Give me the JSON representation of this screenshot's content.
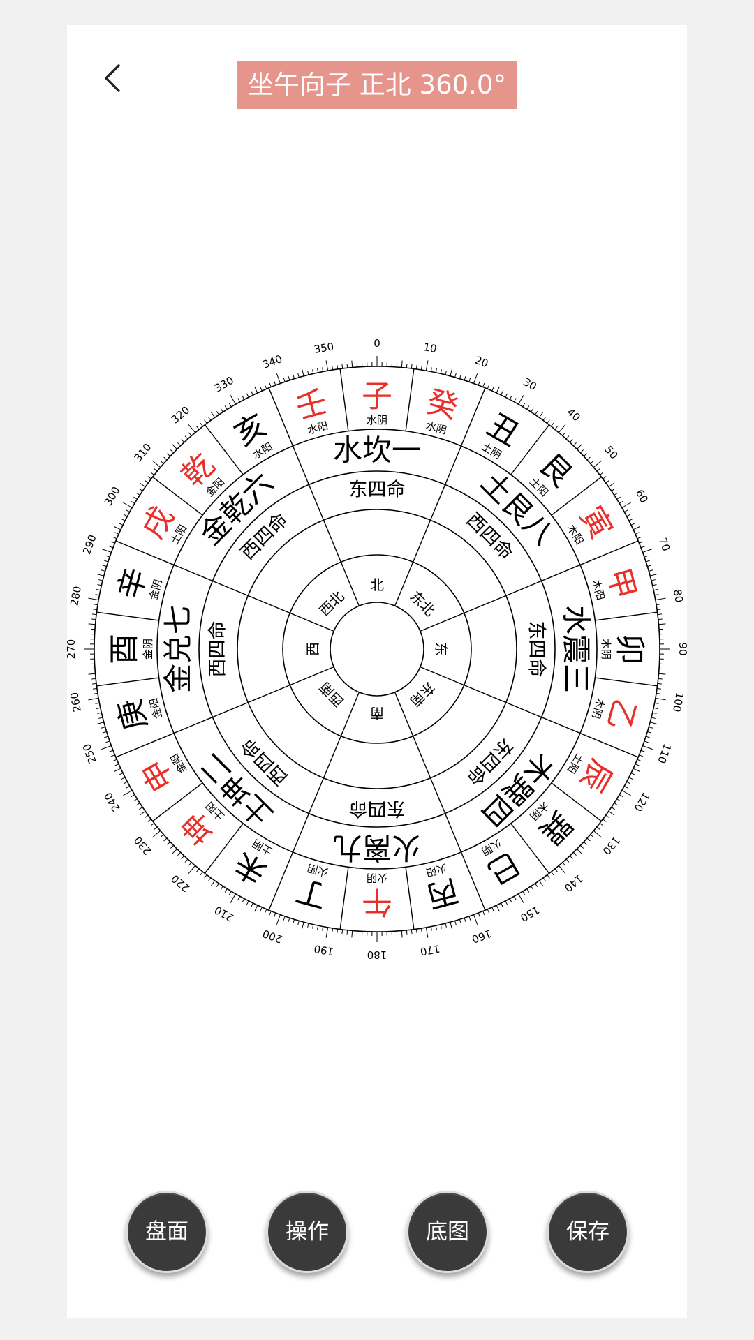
{
  "header": {
    "title": "坐午向子  正北 360.0°",
    "back_icon": "chevron-left-icon"
  },
  "colors": {
    "title_bg": "#e5958c",
    "highlight": "#e8302a",
    "text": "#000000",
    "button_bg": "#3a3a3a"
  },
  "compass": {
    "degree_labels": [
      "0",
      "10",
      "20",
      "30",
      "40",
      "50",
      "60",
      "70",
      "80",
      "90",
      "100",
      "110",
      "120",
      "130",
      "140",
      "150",
      "160",
      "170",
      "180",
      "190",
      "200",
      "210",
      "220",
      "230",
      "240",
      "250",
      "260",
      "270",
      "280",
      "290",
      "300",
      "310",
      "320",
      "330",
      "340",
      "350"
    ],
    "mountains": [
      {
        "name": "子",
        "element": "水阴",
        "red": true
      },
      {
        "name": "癸",
        "element": "水阴",
        "red": true
      },
      {
        "name": "丑",
        "element": "土阴",
        "red": false
      },
      {
        "name": "艮",
        "element": "土阳",
        "red": false
      },
      {
        "name": "寅",
        "element": "木阳",
        "red": true
      },
      {
        "name": "甲",
        "element": "木阳",
        "red": true
      },
      {
        "name": "卯",
        "element": "木阴",
        "red": false
      },
      {
        "name": "乙",
        "element": "木阴",
        "red": true
      },
      {
        "name": "辰",
        "element": "土阳",
        "red": true
      },
      {
        "name": "巽",
        "element": "木阴",
        "red": false
      },
      {
        "name": "巳",
        "element": "火阴",
        "red": false
      },
      {
        "name": "丙",
        "element": "火阳",
        "red": false
      },
      {
        "name": "午",
        "element": "火阴",
        "red": true
      },
      {
        "name": "丁",
        "element": "火阴",
        "red": false
      },
      {
        "name": "未",
        "element": "土阴",
        "red": false
      },
      {
        "name": "坤",
        "element": "土阳",
        "red": true
      },
      {
        "name": "申",
        "element": "金阳",
        "red": true
      },
      {
        "name": "庚",
        "element": "金阳",
        "red": false
      },
      {
        "name": "酉",
        "element": "金阴",
        "red": false
      },
      {
        "name": "辛",
        "element": "金阴",
        "red": false
      },
      {
        "name": "戌",
        "element": "土阳",
        "red": true
      },
      {
        "name": "乾",
        "element": "金阳",
        "red": true
      },
      {
        "name": "亥",
        "element": "水阳",
        "red": false
      },
      {
        "name": "壬",
        "element": "水阳",
        "red": true
      }
    ],
    "trigrams": [
      "水坎一",
      "土艮八",
      "水震三",
      "木巽四",
      "火离九",
      "土坤二",
      "金兑七",
      "金乾六"
    ],
    "life_groups": [
      "东四命",
      "西四命",
      "东四命",
      "东四命",
      "东四命",
      "西四命",
      "西四命",
      "西四命"
    ],
    "directions": [
      "北",
      "东北",
      "东",
      "东南",
      "南",
      "西南",
      "西",
      "西北"
    ]
  },
  "buttons": {
    "panel": "盘面",
    "operate": "操作",
    "background": "底图",
    "save": "保存"
  }
}
